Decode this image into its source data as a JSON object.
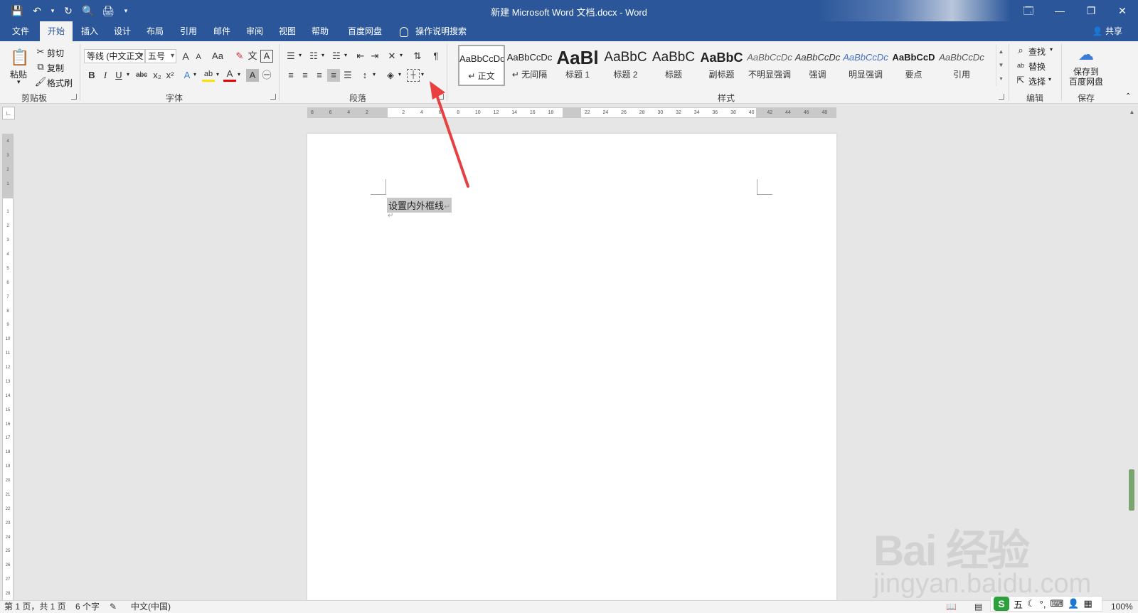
{
  "window": {
    "title": "新建 Microsoft Word 文档.docx  -  Word",
    "controls": [
      "🗔",
      "—",
      "❐",
      "✕"
    ]
  },
  "qat": [
    "💾",
    "↶",
    "▾",
    "↻",
    "🔍",
    "🖨",
    "▾"
  ],
  "tabs": [
    {
      "label": "文件",
      "active": false
    },
    {
      "label": "开始",
      "active": true
    },
    {
      "label": "插入",
      "active": false
    },
    {
      "label": "设计",
      "active": false
    },
    {
      "label": "布局",
      "active": false
    },
    {
      "label": "引用",
      "active": false
    },
    {
      "label": "邮件",
      "active": false
    },
    {
      "label": "审阅",
      "active": false
    },
    {
      "label": "视图",
      "active": false
    },
    {
      "label": "帮助",
      "active": false
    },
    {
      "label": "百度网盘",
      "active": false
    }
  ],
  "tell_me": "操作说明搜索",
  "share": "共享",
  "clipboard": {
    "paste": "粘贴",
    "cut": "剪切",
    "copy": "复制",
    "format_painter": "格式刷",
    "label": "剪贴板"
  },
  "font": {
    "font_name": "等线 (中文正文",
    "font_size": "五号",
    "grow": "A",
    "shrink": "A",
    "change_case": "Aa",
    "clear": "✎",
    "phonetic": "文",
    "border_char": "A",
    "bold": "B",
    "italic": "I",
    "underline": "U",
    "strike": "abc",
    "subscript": "x₂",
    "superscript": "x²",
    "effects": "A",
    "highlight": "ab",
    "font_color": "A",
    "shading": "A",
    "enclose": "㊀",
    "label": "字体"
  },
  "paragraph": {
    "label": "段落"
  },
  "styles": {
    "label": "样式",
    "items": [
      {
        "sample": "AaBbCcDc",
        "name": "↵ 正文",
        "size": 13,
        "bold": false,
        "italic": false,
        "color": "#222222",
        "selected": true
      },
      {
        "sample": "AaBbCcDc",
        "name": "↵ 无间隔",
        "size": 13,
        "bold": false,
        "italic": false,
        "color": "#222222",
        "selected": false
      },
      {
        "sample": "AaBl",
        "name": "标题 1",
        "size": 26,
        "bold": true,
        "italic": false,
        "color": "#222222",
        "selected": false
      },
      {
        "sample": "AaBbC",
        "name": "标题 2",
        "size": 19,
        "bold": false,
        "italic": false,
        "color": "#222222",
        "selected": false
      },
      {
        "sample": "AaBbC",
        "name": "标题",
        "size": 19,
        "bold": false,
        "italic": false,
        "color": "#222222",
        "selected": false
      },
      {
        "sample": "AaBbC",
        "name": "副标题",
        "size": 18,
        "bold": true,
        "italic": false,
        "color": "#222222",
        "selected": false
      },
      {
        "sample": "AaBbCcDc",
        "name": "不明显强调",
        "size": 13,
        "bold": false,
        "italic": true,
        "color": "#666666",
        "selected": false
      },
      {
        "sample": "AaBbCcDc",
        "name": "强调",
        "size": 13,
        "bold": false,
        "italic": true,
        "color": "#333333",
        "selected": false
      },
      {
        "sample": "AaBbCcDc",
        "name": "明显强调",
        "size": 13,
        "bold": false,
        "italic": true,
        "color": "#4472c4",
        "selected": false
      },
      {
        "sample": "AaBbCcD",
        "name": "要点",
        "size": 13,
        "bold": true,
        "italic": false,
        "color": "#222222",
        "selected": false
      },
      {
        "sample": "AaBbCcDc",
        "name": "引用",
        "size": 13,
        "bold": false,
        "italic": true,
        "color": "#555555",
        "selected": false
      }
    ]
  },
  "editing": {
    "find": "查找",
    "replace": "替换",
    "select": "选择",
    "label": "编辑"
  },
  "save_group": {
    "button": "保存到\n百度网盘",
    "label": "保存"
  },
  "ruler": {
    "h_labels": [
      "8",
      "6",
      "4",
      "2",
      "",
      "2",
      "4",
      "6",
      "8",
      "10",
      "12",
      "14",
      "16",
      "18",
      "",
      "22",
      "24",
      "26",
      "28",
      "30",
      "32",
      "34",
      "36",
      "38",
      "40",
      "42",
      "44",
      "46",
      "48"
    ],
    "v_labels": [
      "4",
      "3",
      "2",
      "1",
      "",
      "1",
      "2",
      "3",
      "4",
      "5",
      "6",
      "7",
      "8",
      "9",
      "10",
      "11",
      "12",
      "13",
      "14",
      "15",
      "16",
      "17",
      "18",
      "19",
      "20",
      "21",
      "22",
      "23",
      "24",
      "25",
      "26",
      "27",
      "28"
    ]
  },
  "document": {
    "line1": "设置内外框线",
    "para_mark": "↵"
  },
  "status": {
    "page": "第 1 页，共 1 页",
    "words": "6 个字",
    "language": "中文(中国)",
    "zoom": "100%"
  },
  "ime": {
    "logo": "S",
    "mode": "五",
    "icons": [
      "☾",
      "°,",
      "⌨",
      "👤",
      "▦"
    ]
  },
  "watermark": {
    "main": "Bai 经验",
    "url": "jingyan.baidu.com"
  },
  "colors": {
    "accent": "#2b579a",
    "annotation_arrow": "#e84040"
  }
}
